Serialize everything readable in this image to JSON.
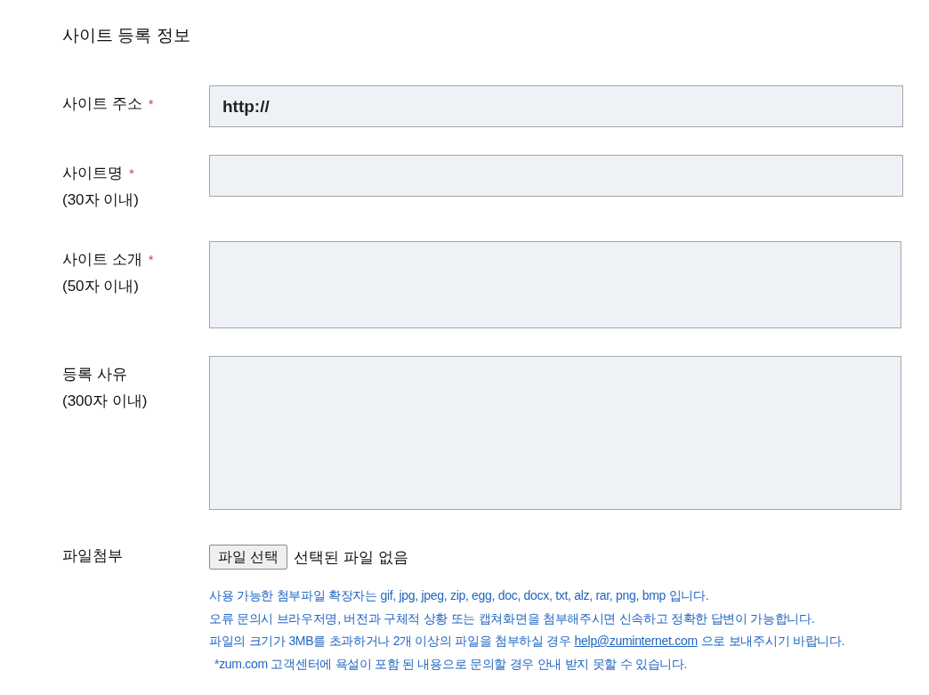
{
  "section_title": "사이트 등록 정보",
  "required_symbol": "*",
  "fields": [
    {
      "kind": "input",
      "label": "사이트 주소",
      "required": true,
      "value": "http://"
    },
    {
      "kind": "input",
      "label": "사이트명",
      "required": true,
      "hint": "(30자 이내)"
    },
    {
      "kind": "textarea",
      "label": "사이트 소개",
      "required": true,
      "hint": "(50자 이내)"
    },
    {
      "kind": "longtext",
      "label": "등록 사유",
      "required": false,
      "hint": "(300자 이내)"
    },
    {
      "kind": "file",
      "label": "파일첨부",
      "required": false,
      "button": "파일 선택",
      "status": "선택된 파일 없음"
    }
  ],
  "notes": [
    {
      "kind": "plain",
      "text": "사용 가능한 첨부파일 확장자는 gif, jpg, jpeg, zip, egg, doc, docx, txt, alz, rar, png, bmp 입니다."
    },
    {
      "kind": "plain",
      "text": "오류 문의시 브라우저명, 버전과 구체적 상황 또는 캡쳐화면을 첨부해주시면 신속하고 정확한 답변이 가능합니다."
    },
    {
      "kind": "link",
      "before": "파일의 크기가 3MB를 초과하거나 2개 이상의 파일을 첨부하실 경우",
      "link": "help@zuminternet.com",
      "after": "으로 보내주시기 바랍니다."
    },
    {
      "kind": "footnote",
      "text": "*zum.com 고객센터에 욕설이 포함 된 내용으로 문의할 경우 안내 받지 못할 수 있습니다."
    }
  ]
}
